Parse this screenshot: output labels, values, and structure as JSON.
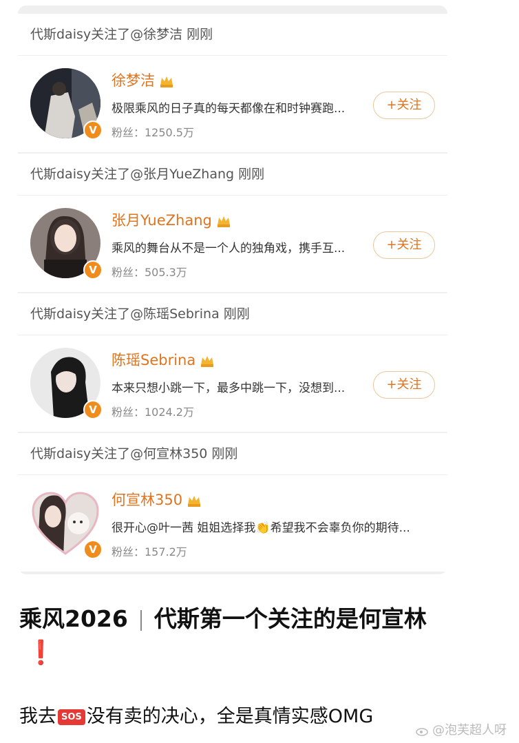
{
  "cards": [
    {
      "header": "代斯daisy关注了@徐梦洁 刚刚",
      "name": "徐梦洁",
      "desc": "极限乘风的日子真的每天都像在和时钟赛跑...",
      "fans": "粉丝：1250.5万",
      "button": "+关注"
    },
    {
      "header": "代斯daisy关注了@张月YueZhang 刚刚",
      "name": "张月YueZhang",
      "desc": "乘风的舞台从不是一个人的独角戏，携手互...",
      "fans": "粉丝：505.3万",
      "button": "+关注"
    },
    {
      "header": "代斯daisy关注了@陈瑶Sebrina 刚刚",
      "name": "陈瑶Sebrina",
      "desc": "本来只想小跳一下，最多中跳一下，没想到...",
      "fans": "粉丝：1024.2万",
      "button": "+关注"
    },
    {
      "header": "代斯daisy关注了@何宣林350 刚刚",
      "name": "何宣林350",
      "desc": "很开心@叶一茜 姐姐选择我👏希望我不会辜负你的期待...",
      "fans": "粉丝：157.2万"
    }
  ],
  "verified_badge": "V",
  "post": {
    "title_left": "乘风2026",
    "title_right": "代斯第一个关注的是何宣林",
    "exclaim": "❗",
    "body_before": "我去",
    "sos": "SOS",
    "body_after": "没有卖的决心，全是真情实感OMG"
  },
  "watermark": "@泡芙超人呀",
  "colors": {
    "accent": "#e0741e",
    "badge": "#f08c1c",
    "button_border": "#e8c79a"
  }
}
